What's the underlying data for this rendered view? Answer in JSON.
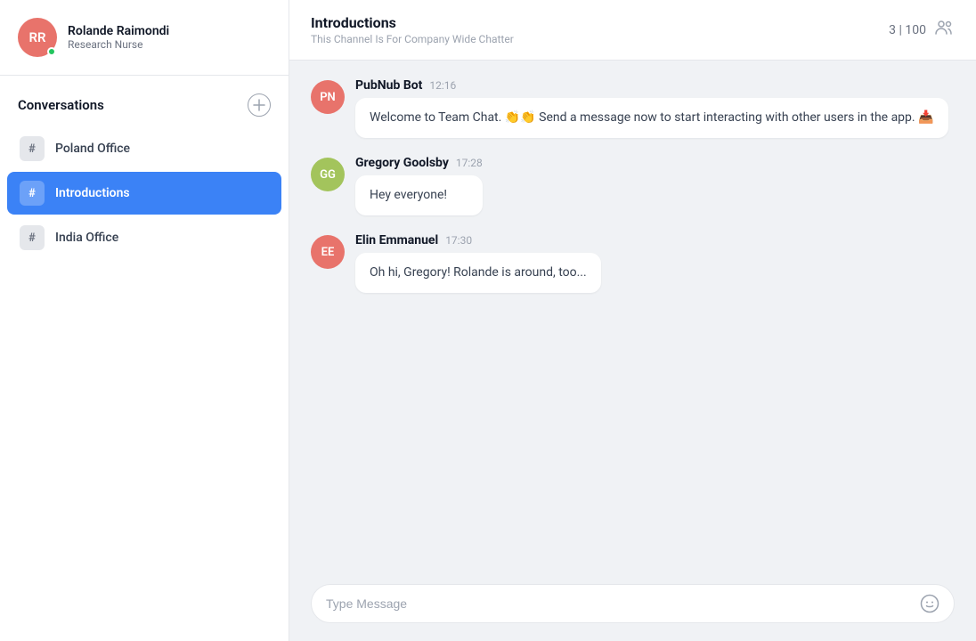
{
  "user": {
    "initials": "RR",
    "name": "Rolande Raimondi",
    "role": "Research Nurse",
    "online": true
  },
  "sidebar": {
    "conversations_label": "Conversations",
    "add_button_label": "+",
    "channels": [
      {
        "id": "poland-office",
        "hash": "#",
        "name": "Poland Office",
        "active": false
      },
      {
        "id": "introductions",
        "hash": "#",
        "name": "Introductions",
        "active": true
      },
      {
        "id": "india-office",
        "hash": "#",
        "name": "India Office",
        "active": false
      }
    ]
  },
  "chat": {
    "channel_name": "Introductions",
    "channel_desc": "This Channel Is For Company Wide Chatter",
    "member_count": "3 | 100",
    "messages": [
      {
        "id": "msg1",
        "avatar_initials": "PN",
        "avatar_class": "pn",
        "sender": "PubNub Bot",
        "time": "12:16",
        "text": "Welcome to Team Chat. 👏👏 Send a message now to start interacting with other users in the app. 📥"
      },
      {
        "id": "msg2",
        "avatar_initials": "GG",
        "avatar_class": "gg",
        "sender": "Gregory Goolsby",
        "time": "17:28",
        "text": "Hey everyone!"
      },
      {
        "id": "msg3",
        "avatar_initials": "EE",
        "avatar_class": "ee",
        "sender": "Elin Emmanuel",
        "time": "17:30",
        "text": "Oh hi, Gregory! Rolande is around, too..."
      }
    ],
    "input_placeholder": "Type Message",
    "emoji_icon": "🙂"
  }
}
